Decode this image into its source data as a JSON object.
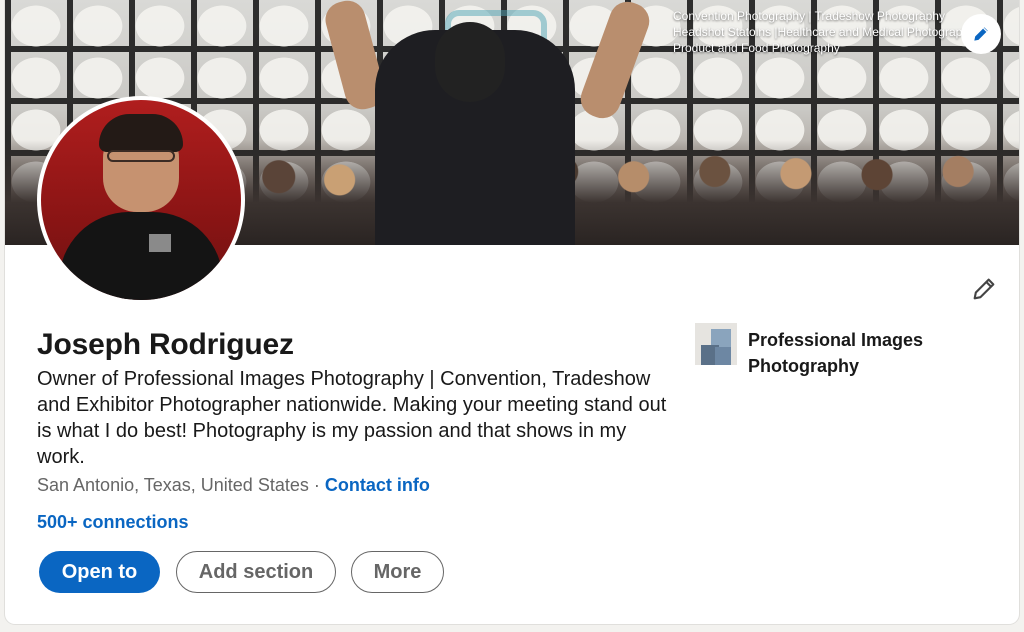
{
  "banner": {
    "caption_lines": [
      "Convention Photography | Tradeshow Photography",
      "Headshot Statoins |Healthcare and Medical Photography",
      "Product and Food Photography"
    ],
    "edit_icon": "pencil-icon"
  },
  "profile": {
    "name": "Joseph Rodriguez",
    "headline": "Owner of Professional Images Photography | Convention, Tradeshow and Exhibitor Photographer nationwide. Making your meeting stand out is what I do best! Photography is my passion and that shows in my work.",
    "location": "San Antonio, Texas, United States",
    "separator": "·",
    "contact_info": "Contact info",
    "connections": "500+ connections",
    "edit_icon": "pencil-icon"
  },
  "company": {
    "name": "Professional Images Photography"
  },
  "actions": {
    "open_to": "Open to",
    "add_section": "Add section",
    "more": "More"
  },
  "colors": {
    "accent": "#0a66c2",
    "text": "#191919",
    "muted": "#666666"
  }
}
